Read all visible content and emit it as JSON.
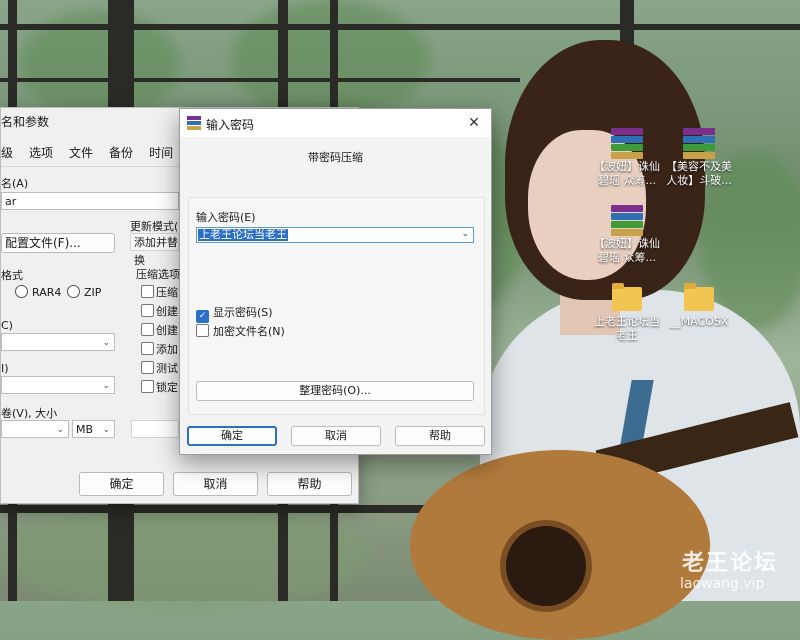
{
  "desktop": {
    "icons": [
      {
        "type": "rar",
        "label": "【波妞】诛仙碧瑶 众筹..."
      },
      {
        "type": "rar",
        "label": "【美容不及美人妆】斗破..."
      },
      {
        "type": "rar",
        "label": "【波妞】诛仙碧瑶 众筹..."
      },
      {
        "type": "folder",
        "label": "上老王论坛当老王"
      },
      {
        "type": "folder",
        "label": "__MACOSX"
      }
    ],
    "watermark": {
      "text": "老王论坛",
      "url": "laowang.vip"
    }
  },
  "archive_dialog": {
    "title": "名和参数",
    "tabs": [
      "级",
      "选项",
      "文件",
      "备份",
      "时间"
    ],
    "name_label": "名(A)",
    "name_value": "ar",
    "update_mode_label": "更新模式(U",
    "update_mode_value": "添加并替换",
    "profiles_button": "配置文件(F)...",
    "format_label": "格式",
    "format_options": [
      "RAR4",
      "ZIP"
    ],
    "compress_options_label": "压缩选项",
    "compress_options": [
      "压缩",
      "创建",
      "创建",
      "添加",
      "测试",
      "锁定"
    ],
    "method_label": "C)",
    "dict_label": "I)",
    "split_label": "卷(V), 大小",
    "split_unit": "MB",
    "ok": "确定",
    "cancel": "取消",
    "help": "帮助"
  },
  "password_dialog": {
    "title": "输入密码",
    "subtitle": "带密码压缩",
    "password_label": "输入密码(E)",
    "password_value": "上老王论坛当老王",
    "show_password_label": "显示密码(S)",
    "show_password_checked": true,
    "encrypt_names_label": "加密文件名(N)",
    "encrypt_names_checked": false,
    "organize_button": "整理密码(O)...",
    "ok": "确定",
    "cancel": "取消",
    "help": "帮助"
  }
}
